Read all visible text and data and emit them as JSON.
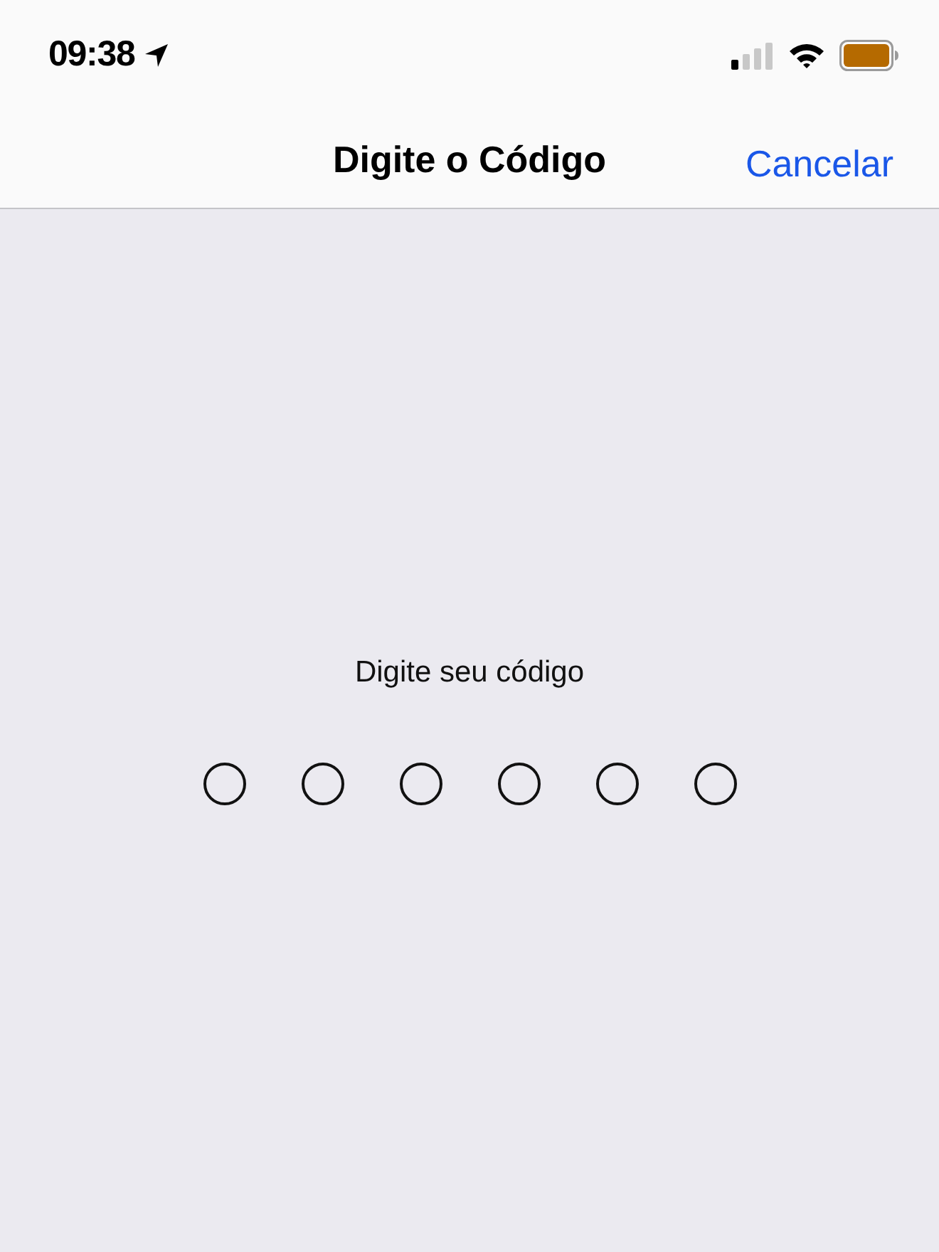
{
  "status_bar": {
    "time": "09:38"
  },
  "nav_bar": {
    "title": "Digite o Código",
    "cancel": "Cancelar"
  },
  "prompt": "Digite seu código",
  "code_digits": [
    {
      "filled": false
    },
    {
      "filled": false
    },
    {
      "filled": false
    },
    {
      "filled": false
    },
    {
      "filled": false
    },
    {
      "filled": false
    }
  ]
}
